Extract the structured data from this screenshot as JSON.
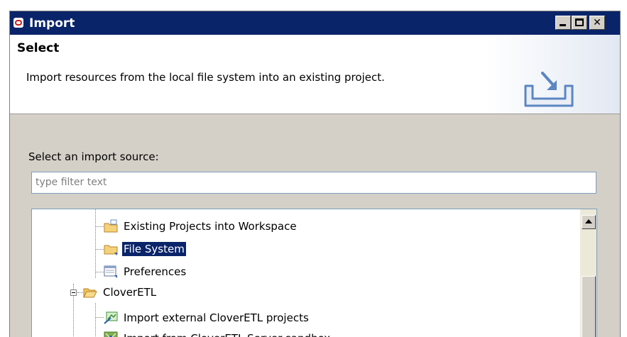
{
  "window": {
    "title": "Import",
    "controls": {
      "minimize": "",
      "maximize": "",
      "close": "✕"
    }
  },
  "header": {
    "title": "Select",
    "description": "Import resources from the local file system into an existing project."
  },
  "source": {
    "label": "Select an import source:",
    "filter_placeholder": "type filter text"
  },
  "tree": {
    "items": [
      {
        "label": "Existing Projects into Workspace",
        "icon": "project-folder-icon",
        "selected": false
      },
      {
        "label": "File System",
        "icon": "folder-icon",
        "selected": true
      },
      {
        "label": "Preferences",
        "icon": "preferences-icon",
        "selected": false
      },
      {
        "label": "CloverETL",
        "icon": "open-folder-icon",
        "expanded": true
      },
      {
        "label": "Import external CloverETL projects",
        "icon": "clover-project-icon",
        "selected": false
      },
      {
        "label": "Import from CloverETL Server sandbox",
        "icon": "clover-server-icon",
        "selected": false
      }
    ]
  },
  "colors": {
    "titlebar": "#0a246a",
    "selection": "#0a246a",
    "dialog_bg": "#d4d0c8"
  }
}
